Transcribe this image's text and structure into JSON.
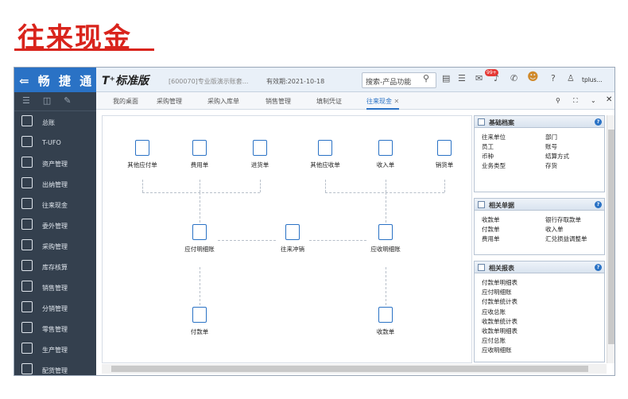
{
  "banner": {
    "title": "往来现金"
  },
  "topbar": {
    "brand": "⇐ 畅 捷 通",
    "product": "T⁺标准版",
    "account": "[600070]专业版演示账套...",
    "valid": "有效期:2021-10-18",
    "search": "搜索-产品功能",
    "badge": "99+",
    "user": "tplus..."
  },
  "sidebar": {
    "items": [
      {
        "label": "总账",
        "icon": "ledger-icon"
      },
      {
        "label": "T-UFO",
        "icon": "ufo-icon"
      },
      {
        "label": "资产管理",
        "icon": "asset-icon"
      },
      {
        "label": "出纳管理",
        "icon": "cashier-icon"
      },
      {
        "label": "往来现金",
        "icon": "cash-icon"
      },
      {
        "label": "委外管理",
        "icon": "outsource-icon"
      },
      {
        "label": "采购管理",
        "icon": "purchase-icon"
      },
      {
        "label": "库存核算",
        "icon": "inventory-icon"
      },
      {
        "label": "销售管理",
        "icon": "sales-icon"
      },
      {
        "label": "分销管理",
        "icon": "distribution-icon"
      },
      {
        "label": "零售管理",
        "icon": "retail-icon"
      },
      {
        "label": "生产管理",
        "icon": "production-icon"
      },
      {
        "label": "配货管理",
        "icon": "allocation-icon"
      }
    ]
  },
  "tabs": [
    {
      "label": "我的桌面"
    },
    {
      "label": "采购管理"
    },
    {
      "label": "采购入库单"
    },
    {
      "label": "销售管理"
    },
    {
      "label": "填制凭证"
    },
    {
      "label": "往来现金"
    }
  ],
  "flow": {
    "top": [
      {
        "label": "其他应付单",
        "icon": "payable-other-icon"
      },
      {
        "label": "费用单",
        "icon": "expense-icon"
      },
      {
        "label": "进货单",
        "icon": "purchase-receipt-icon"
      },
      {
        "label": "其他应收单",
        "icon": "receivable-other-icon"
      },
      {
        "label": "收入单",
        "icon": "income-icon"
      },
      {
        "label": "销货单",
        "icon": "sales-cart-icon"
      }
    ],
    "payable_detail": "应付明细账",
    "offset": "往来冲销",
    "receivable_detail": "应收明细账",
    "payment": "付款单",
    "receipt": "收款单"
  },
  "panels": {
    "basic": {
      "title": "基础档案",
      "left": [
        "往来单位",
        "员工",
        "币种",
        "业务类型"
      ],
      "right": [
        "部门",
        "账号",
        "结算方式",
        "存货"
      ]
    },
    "related_docs": {
      "title": "相关单据",
      "left": [
        "收款单",
        "付款单",
        "费用单"
      ],
      "right": [
        "银行存取款单",
        "收入单",
        "汇兑损益调整单"
      ]
    },
    "reports": {
      "title": "相关报表",
      "items": [
        "付款单明细表",
        "应付明细账",
        "付款单统计表",
        "应收总账",
        "收款单统计表",
        "收款单明细表",
        "应付总账",
        "应收明细账"
      ]
    }
  },
  "colors": {
    "brand": "#2a72c5",
    "banner": "#d9241c",
    "sidebar": "#34404e"
  }
}
